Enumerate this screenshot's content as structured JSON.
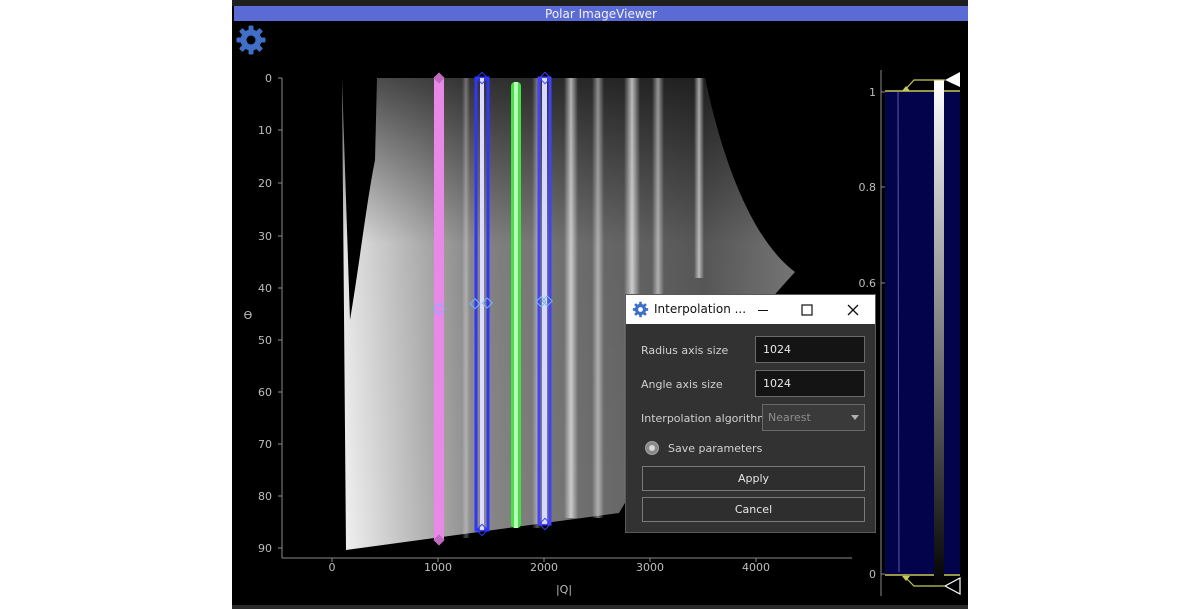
{
  "window": {
    "title": "Polar ImageViewer"
  },
  "plot": {
    "y_axis_label": "ϴ",
    "x_axis_label": "|Q|",
    "y_ticks": [
      "0",
      "10",
      "20",
      "30",
      "40",
      "50",
      "60",
      "70",
      "80",
      "90"
    ],
    "x_ticks": [
      "0",
      "1000",
      "2000",
      "3000",
      "4000"
    ],
    "roi_bands": [
      {
        "color": "#e07ee0",
        "q_center": 1000
      },
      {
        "color": "#3a3aff",
        "q_center": 1400
      },
      {
        "color": "#3ddc3d",
        "q_center": 1700
      },
      {
        "color": "#4a4aff",
        "q_center": 2000
      }
    ]
  },
  "colorbar": {
    "ticks": [
      "1",
      "0.8",
      "0.6",
      "0"
    ]
  },
  "dialog": {
    "title": "Interpolation ...",
    "radius_label": "Radius axis size",
    "radius_value": "1024",
    "angle_label": "Angle axis size",
    "angle_value": "1024",
    "algorithm_label": "Interpolation algorithm",
    "algorithm_value": "Nearest",
    "save_label": "Save parameters",
    "apply_label": "Apply",
    "cancel_label": "Cancel"
  },
  "colors": {
    "titlebar": "#5b6bd6",
    "gear": "#3f6fc6",
    "colorbar_fill": "#02034a"
  },
  "icons": {
    "settings": "gear-icon",
    "minimize": "minimize-icon",
    "maximize": "maximize-icon",
    "close": "close-icon"
  }
}
